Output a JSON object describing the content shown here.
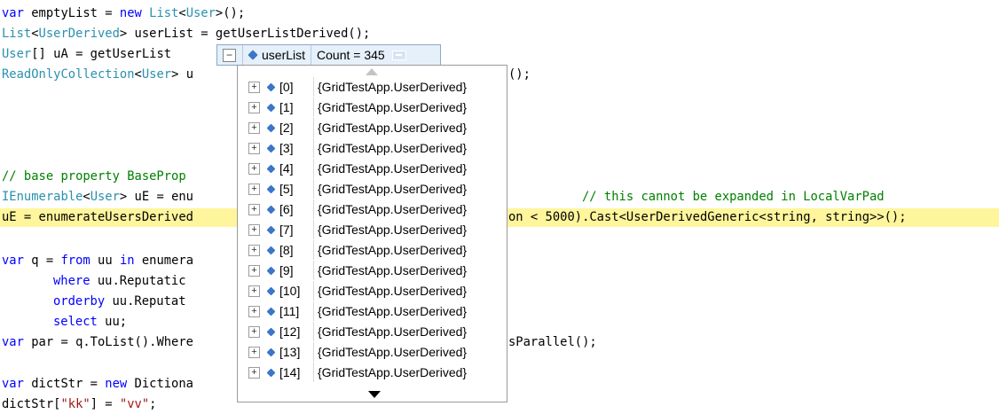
{
  "code": {
    "l1": [
      "var",
      " emptyList = ",
      "new",
      " ",
      "List",
      "<",
      "User",
      ">();"
    ],
    "l2": [
      "List",
      "<",
      "UserDerived",
      "> userList = getUserListDerived();"
    ],
    "l3": [
      "User",
      "[] uA = getUserList"
    ],
    "l4": [
      "ReadOnlyCollection",
      "<",
      "User",
      "> u",
      "();"
    ],
    "l5": [
      "// base property BaseProp "
    ],
    "l6": [
      "IEnumerable",
      "<",
      "User",
      "> uE = enu",
      "// this cannot be expanded in LocalVarPad"
    ],
    "l7": [
      "uE = enumerateUsersDerived",
      "on < 5000).Cast<UserDerivedGeneric<string, string>>();"
    ],
    "l8": [
      "var",
      " q = ",
      "from",
      " uu ",
      "in",
      " enumera"
    ],
    "l9": [
      "where",
      " uu.Reputatic"
    ],
    "l10": [
      "orderby",
      " uu.Reputat"
    ],
    "l11": [
      "select",
      " uu;"
    ],
    "l12": [
      "var",
      " par = q.ToList().Where",
      "sParallel();"
    ],
    "l13": [
      "var",
      " dictStr = ",
      "new",
      " Dictiona"
    ],
    "l14": [
      "dictStr[",
      "\"kk\"",
      "] = ",
      "\"vv\"",
      ";"
    ]
  },
  "datatip": {
    "expand_glyph": "−",
    "name": "userList",
    "value": "Count = 345"
  },
  "dropdown": {
    "expand_glyph": "+",
    "items": [
      {
        "index": "[0]",
        "value": "{GridTestApp.UserDerived}"
      },
      {
        "index": "[1]",
        "value": "{GridTestApp.UserDerived}"
      },
      {
        "index": "[2]",
        "value": "{GridTestApp.UserDerived}"
      },
      {
        "index": "[3]",
        "value": "{GridTestApp.UserDerived}"
      },
      {
        "index": "[4]",
        "value": "{GridTestApp.UserDerived}"
      },
      {
        "index": "[5]",
        "value": "{GridTestApp.UserDerived}"
      },
      {
        "index": "[6]",
        "value": "{GridTestApp.UserDerived}"
      },
      {
        "index": "[7]",
        "value": "{GridTestApp.UserDerived}"
      },
      {
        "index": "[8]",
        "value": "{GridTestApp.UserDerived}"
      },
      {
        "index": "[9]",
        "value": "{GridTestApp.UserDerived}"
      },
      {
        "index": "[10]",
        "value": "{GridTestApp.UserDerived}"
      },
      {
        "index": "[11]",
        "value": "{GridTestApp.UserDerived}"
      },
      {
        "index": "[12]",
        "value": "{GridTestApp.UserDerived}"
      },
      {
        "index": "[13]",
        "value": "{GridTestApp.UserDerived}"
      },
      {
        "index": "[14]",
        "value": "{GridTestApp.UserDerived}"
      }
    ]
  },
  "colors": {
    "keyword": "#0000ff",
    "type": "#2b91af",
    "comment": "#008000",
    "string": "#a31515",
    "current_line_highlight": "#fff59d"
  },
  "icons": [
    "collapse-icon",
    "variable-icon",
    "pin-icon",
    "expand-icon",
    "scroll-up-icon",
    "scroll-down-icon"
  ]
}
